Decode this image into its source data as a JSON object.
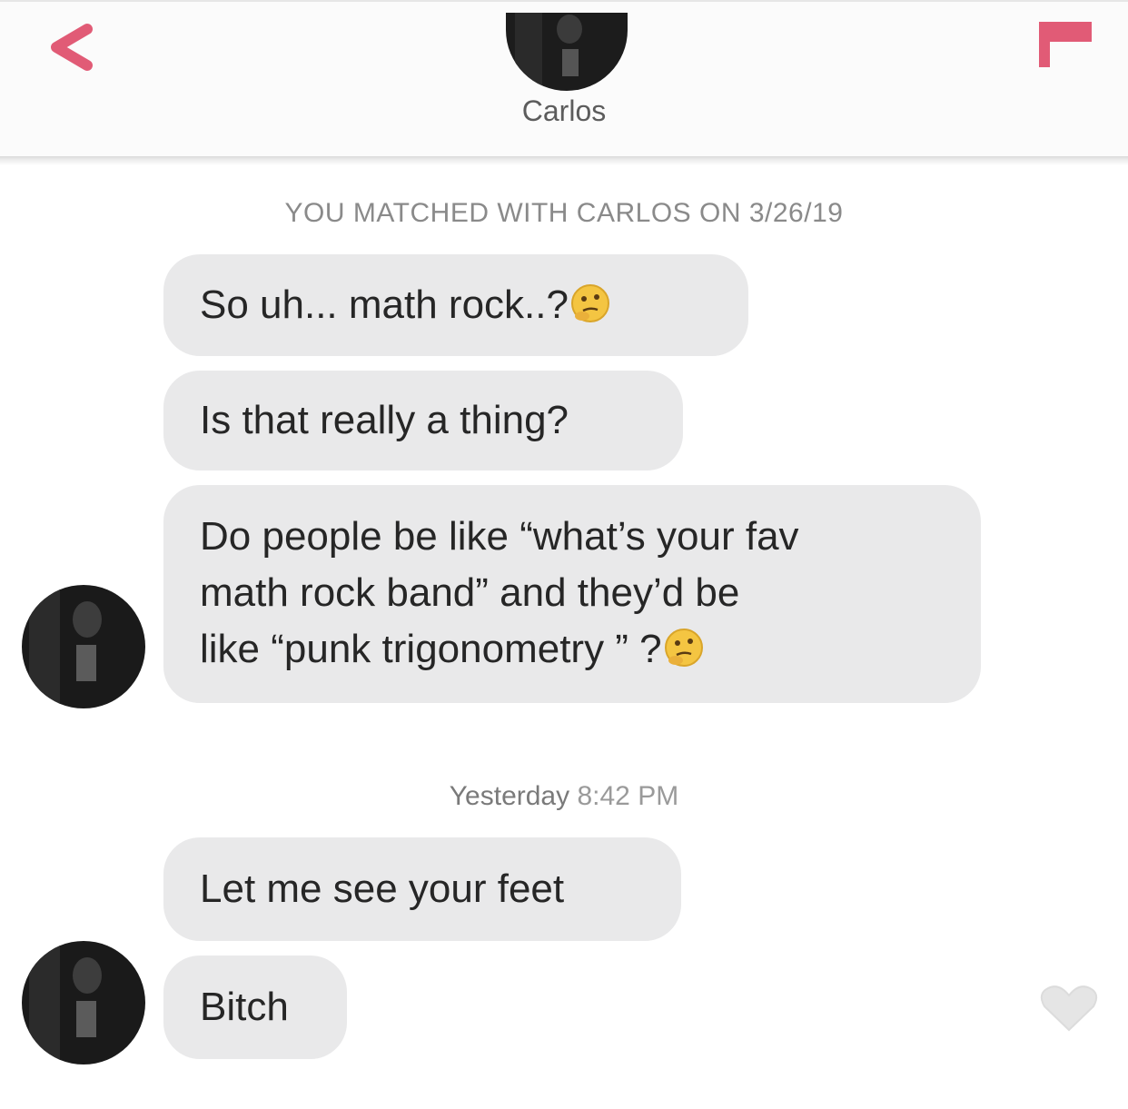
{
  "header": {
    "name": "Carlos",
    "back_icon": "chevron-left-icon",
    "report_icon": "flag-icon",
    "avatar": "profile-photo"
  },
  "conversation": {
    "match_notice": "YOU MATCHED WITH CARLOS ON 3/26/19",
    "messages": [
      {
        "text": "So uh... math rock..?",
        "emoji": "thinking-face-icon"
      },
      {
        "text": "Is that really a thing?"
      },
      {
        "lines": [
          "Do people be like “what’s your fav",
          "math rock band” and they’d be",
          "like “punk trigonometry ” ?"
        ],
        "emoji": "thinking-face-icon"
      },
      {
        "text": "Let me see your feet"
      },
      {
        "text": "Bitch"
      }
    ],
    "timestamp_day": "Yesterday",
    "timestamp_time": "8:42 PM"
  },
  "actions": {
    "like_icon": "heart-icon"
  },
  "colors": {
    "accent": "#e15b76",
    "bubble": "#e9e9ea",
    "heart": "#e5e5e5"
  }
}
